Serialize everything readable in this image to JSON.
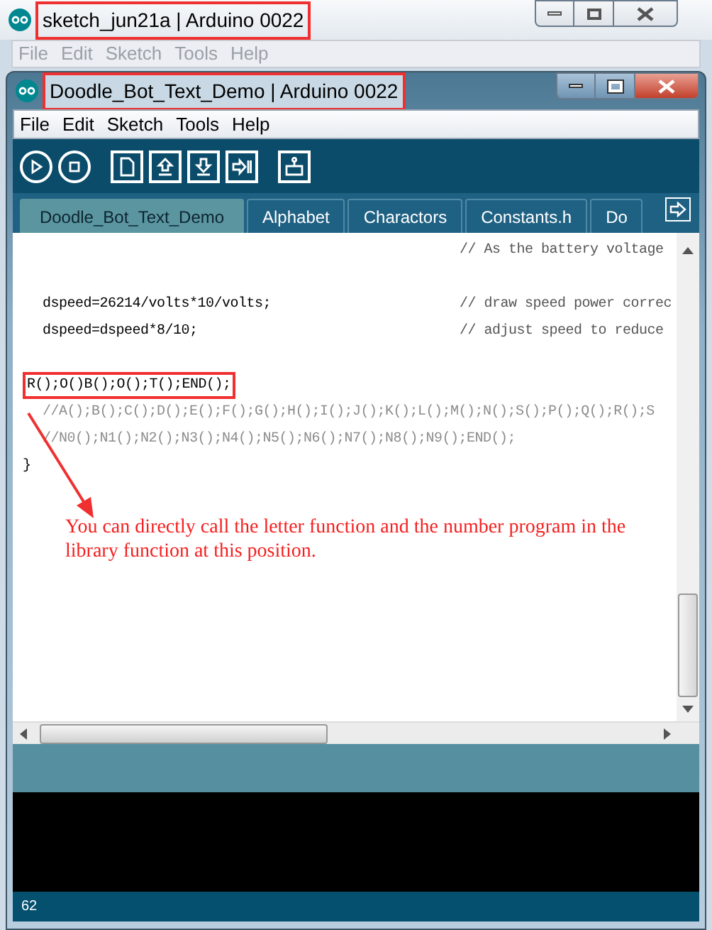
{
  "back_window": {
    "title": "sketch_jun21a | Arduino 0022",
    "menu": [
      {
        "label": "File",
        "disabled": true
      },
      {
        "label": "Edit",
        "disabled": true
      },
      {
        "label": "Sketch",
        "disabled": true
      },
      {
        "label": "Tools",
        "disabled": true
      },
      {
        "label": "Help",
        "disabled": true
      }
    ]
  },
  "window": {
    "title": "Doodle_Bot_Text_Demo | Arduino 0022"
  },
  "menu": [
    {
      "label": "File",
      "disabled": false
    },
    {
      "label": "Edit",
      "disabled": false
    },
    {
      "label": "Sketch",
      "disabled": false
    },
    {
      "label": "Tools",
      "disabled": false
    },
    {
      "label": "Help",
      "disabled": false
    }
  ],
  "tabs": [
    {
      "label": "Doodle_Bot_Text_Demo",
      "selected": true
    },
    {
      "label": "Alphabet",
      "selected": false
    },
    {
      "label": "Charactors",
      "selected": false
    },
    {
      "label": "Constants.h",
      "selected": false
    },
    {
      "label": "Do",
      "selected": false
    }
  ],
  "editor": {
    "lines": [
      {
        "kind": "code",
        "comment": "// As the battery voltage"
      },
      {
        "kind": "blank"
      },
      {
        "kind": "code",
        "text": "dspeed=26214/volts*10/volts;",
        "indented": true,
        "comment": "// draw speed power correc"
      },
      {
        "kind": "code",
        "text": "dspeed=dspeed*8/10;",
        "indented": true,
        "comment": "// adjust speed to reduce"
      },
      {
        "kind": "blank"
      },
      {
        "kind": "code",
        "text": "R();O()B();O();T();END();",
        "indented": false,
        "highlighted": true
      },
      {
        "kind": "comment",
        "text": "//A();B();C();D();E();F();G();H();I();J();K();L();M();N();S();P();Q();R();S",
        "indented": true
      },
      {
        "kind": "comment",
        "text": "//N0();N1();N2();N3();N4();N5();N6();N7();N8();N9();END();",
        "indented": true
      },
      {
        "kind": "code",
        "text": "}",
        "indented": false
      }
    ]
  },
  "annotation": {
    "text": "You can directly call the letter function and the number program in the library function at this position."
  },
  "status_bar": {
    "line": "62"
  }
}
